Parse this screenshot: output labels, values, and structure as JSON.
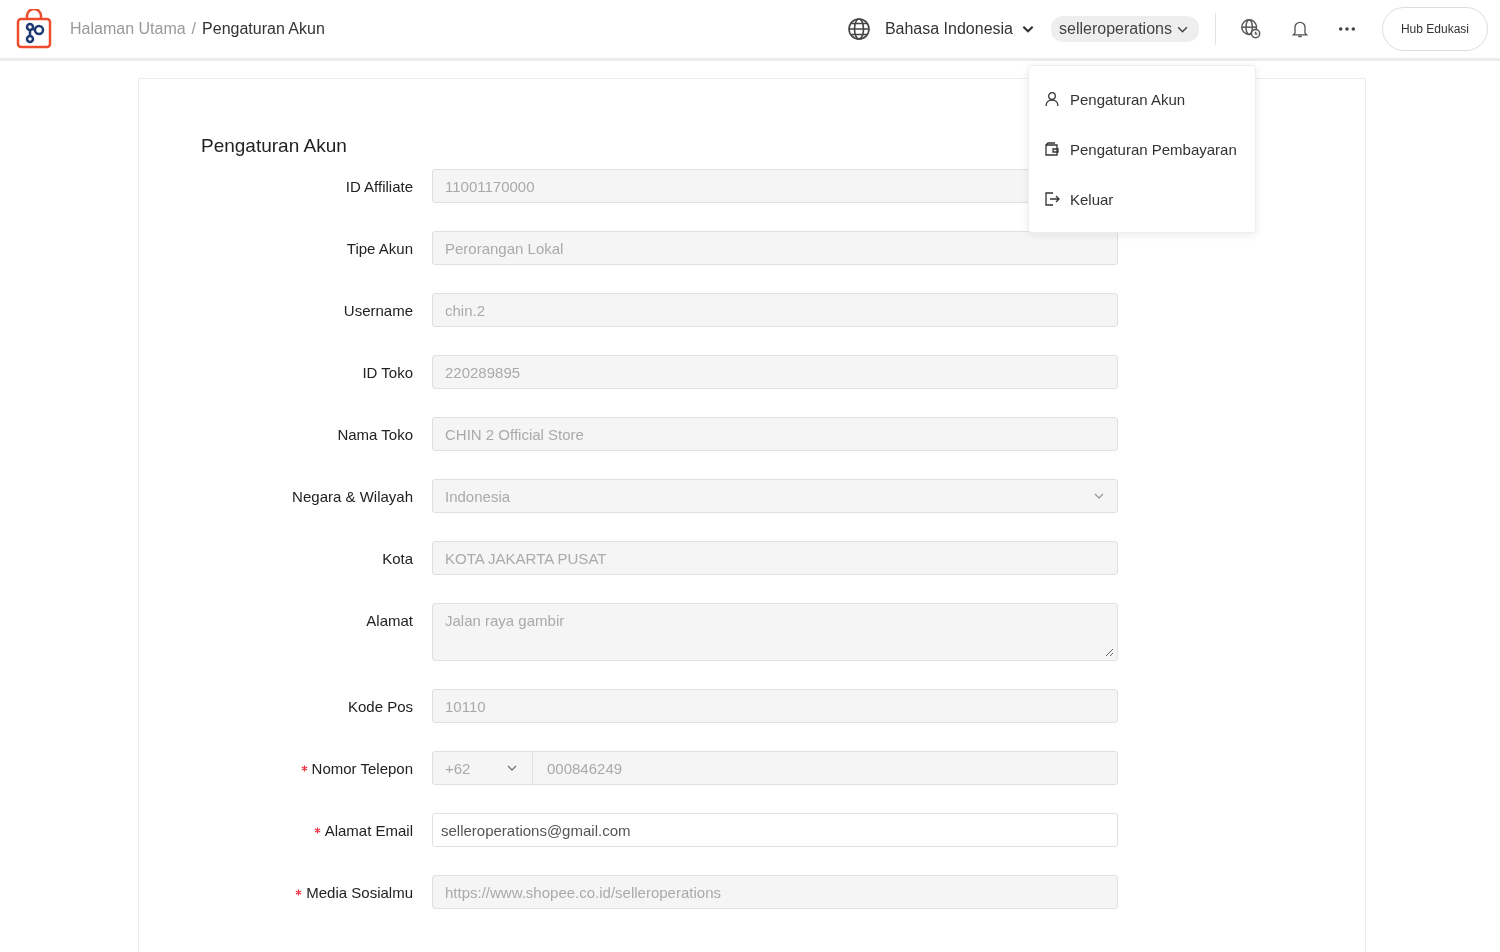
{
  "header": {
    "breadcrumb": [
      {
        "label": "Halaman Utama",
        "selected": false
      },
      {
        "label": "Pengaturan Akun",
        "selected": true
      }
    ],
    "separator": "/",
    "language": "Bahasa Indonesia",
    "account": "selleroperations",
    "education_button": "Hub Edukasi"
  },
  "account_menu": {
    "items": [
      {
        "label": "Pengaturan Akun",
        "kind": "user"
      },
      {
        "label": "Pengaturan Pembayaran",
        "kind": "wallet"
      },
      {
        "label": "Keluar",
        "kind": "logout"
      }
    ]
  },
  "form": {
    "title": "Pengaturan Akun",
    "fields": [
      {
        "label": "ID Affiliate",
        "kind": "input",
        "value": "11001170000",
        "disabled": true,
        "required": false
      },
      {
        "label": "Tipe Akun",
        "kind": "input",
        "value": "Perorangan Lokal",
        "disabled": true,
        "required": false
      },
      {
        "label": "Username",
        "kind": "input",
        "value": "chin.2",
        "disabled": true,
        "required": false
      },
      {
        "label": "ID Toko",
        "kind": "input",
        "value": "220289895",
        "disabled": true,
        "required": false
      },
      {
        "label": "Nama Toko",
        "kind": "input",
        "value": "CHIN 2 Official Store",
        "disabled": true,
        "required": false
      },
      {
        "label": "Negara & Wilayah",
        "kind": "select",
        "value": "Indonesia",
        "disabled": true,
        "required": false
      },
      {
        "label": "Kota",
        "kind": "input",
        "value": "KOTA JAKARTA PUSAT",
        "disabled": true,
        "required": false
      },
      {
        "label": "Alamat",
        "kind": "textarea",
        "value": "Jalan raya gambir",
        "disabled": true,
        "required": false
      },
      {
        "label": "Kode Pos",
        "kind": "input",
        "value": "10110",
        "disabled": true,
        "required": false
      },
      {
        "label": "Nomor Telepon",
        "kind": "phone",
        "prefix": "+62",
        "value": "000846249",
        "disabled": true,
        "required": true
      },
      {
        "label": "Alamat Email",
        "kind": "input",
        "value": "selleroperations@gmail.com",
        "disabled": false,
        "required": true
      },
      {
        "label": "Media Sosialmu",
        "kind": "input",
        "value": "https://www.shopee.co.id/selleroperations",
        "disabled": true,
        "required": true
      }
    ]
  }
}
